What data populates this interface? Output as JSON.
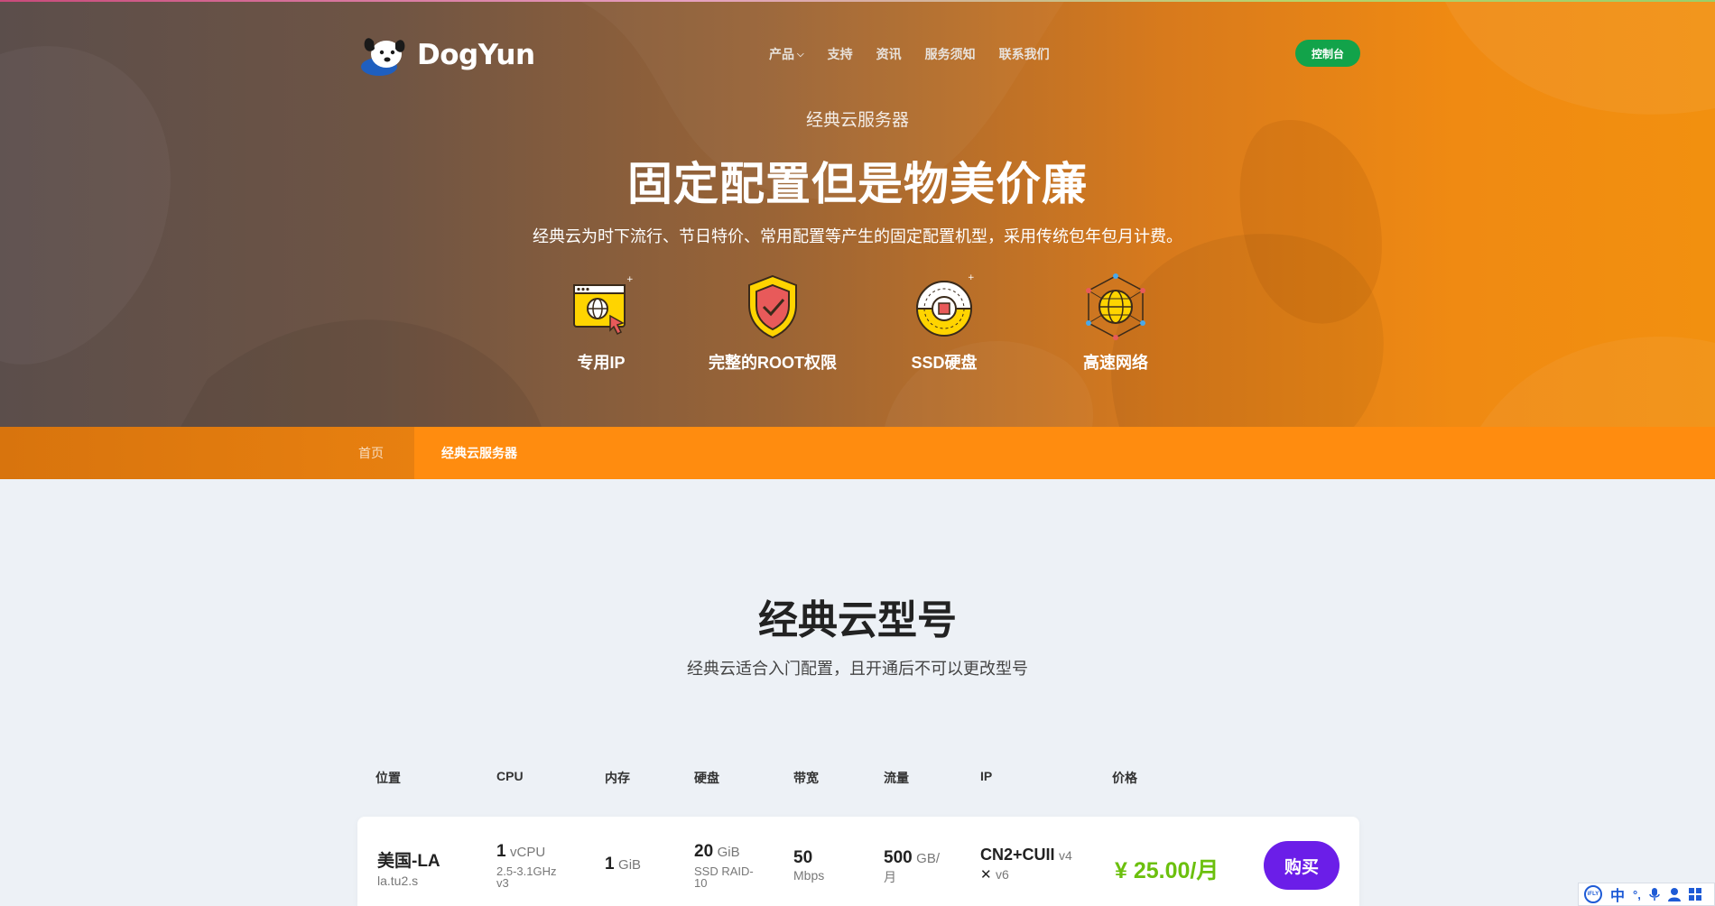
{
  "header": {
    "brand": "DogYun",
    "nav": [
      {
        "label": "产品",
        "has_dropdown": true
      },
      {
        "label": "支持"
      },
      {
        "label": "资讯"
      },
      {
        "label": "服务须知"
      },
      {
        "label": "联系我们"
      }
    ],
    "console_label": "控制台"
  },
  "hero": {
    "kicker": "经典云服务器",
    "headline": "固定配置但是物美价廉",
    "description": "经典云为时下流行、节日特价、常用配置等产生的固定配置机型，采用传统包年包月计费。",
    "features": [
      {
        "label": "专用IP",
        "icon": "browser-globe-cursor-icon"
      },
      {
        "label": "完整的ROOT权限",
        "icon": "shield-check-icon"
      },
      {
        "label": "SSD硬盘",
        "icon": "disk-chip-icon"
      },
      {
        "label": "高速网络",
        "icon": "globe-network-icon"
      }
    ]
  },
  "breadcrumb": {
    "home": "首页",
    "current": "经典云服务器"
  },
  "section": {
    "title": "经典云型号",
    "subtitle": "经典云适合入门配置，且开通后不可以更改型号",
    "columns": [
      "位置",
      "CPU",
      "内存",
      "硬盘",
      "带宽",
      "流量",
      "IP",
      "价格"
    ],
    "rows": [
      {
        "location": "美国-LA",
        "code": "la.tu2.s",
        "cpu_count": "1",
        "cpu_unit": "vCPU",
        "cpu_freq_line1": "2.5-3.1GHz",
        "cpu_freq_line2": "v3",
        "mem_value": "1",
        "mem_unit": "GiB",
        "disk_value": "20",
        "disk_unit": "GiB",
        "disk_type_line1": "SSD RAID-",
        "disk_type_line2": "10",
        "bw_value": "50",
        "bw_unit": "Mbps",
        "traffic_value": "500",
        "traffic_unit_line1": "GB/",
        "traffic_unit_line2": "月",
        "ip_name": "CN2+CUII",
        "ip_v4": "v4",
        "ip_v6_mark": "✕",
        "ip_v6": "v6",
        "price": "¥ 25.00/月",
        "buy_label": "购买"
      }
    ]
  },
  "ime_toolbar": {
    "logo_text": "iFLY",
    "items": [
      "中",
      "°,",
      "mic",
      "user",
      "grid"
    ]
  },
  "colors": {
    "hero_gradient_start": "#5b4e4b",
    "hero_gradient_end": "#f2900f",
    "console_button": "#12a34a",
    "breadcrumb_bar": "#ff8c0f",
    "price": "#6cc00e",
    "buy_button": "#6b1ee8",
    "page_background": "#edf1f6"
  }
}
